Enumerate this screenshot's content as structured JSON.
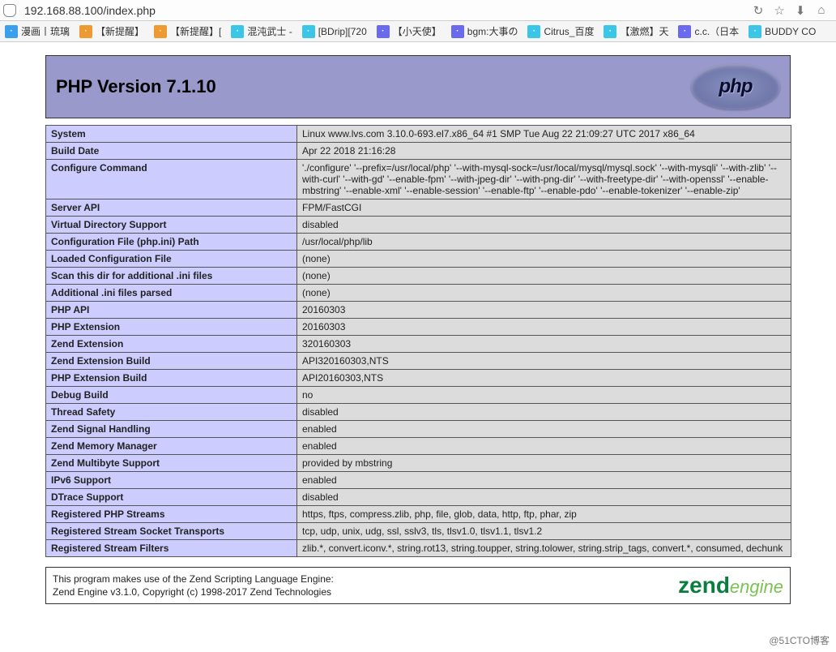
{
  "address_bar": {
    "url": "192.168.88.100/index.php"
  },
  "bookmarks": [
    {
      "label": "漫画丨琉璃",
      "ico": "ico-blue"
    },
    {
      "label": "【新提醒】",
      "ico": "ico-orange"
    },
    {
      "label": "【新提醒】[",
      "ico": "ico-orange"
    },
    {
      "label": "混沌武士 -",
      "ico": "ico-cyan"
    },
    {
      "label": "[BDrip][720",
      "ico": "ico-cyan"
    },
    {
      "label": "【小天使】",
      "ico": "ico-purple"
    },
    {
      "label": "bgm:大事の",
      "ico": "ico-purple"
    },
    {
      "label": "Citrus_百度",
      "ico": "ico-cyan"
    },
    {
      "label": "【激燃】天",
      "ico": "ico-cyan"
    },
    {
      "label": "c.c.（日本",
      "ico": "ico-purple"
    },
    {
      "label": "BUDDY CO",
      "ico": "ico-cyan"
    }
  ],
  "header": {
    "title": "PHP Version 7.1.10",
    "logo_text": "php"
  },
  "rows": [
    {
      "k": "System",
      "v": "Linux www.lvs.com 3.10.0-693.el7.x86_64 #1 SMP Tue Aug 22 21:09:27 UTC 2017 x86_64"
    },
    {
      "k": "Build Date",
      "v": "Apr 22 2018 21:16:28"
    },
    {
      "k": "Configure Command",
      "v": "'./configure' '--prefix=/usr/local/php' '--with-mysql-sock=/usr/local/mysql/mysql.sock' '--with-mysqli' '--with-zlib' '--with-curl' '--with-gd' '--enable-fpm' '--with-jpeg-dir' '--with-png-dir' '--with-freetype-dir' '--with-openssl' '--enable-mbstring' '--enable-xml' '--enable-session' '--enable-ftp' '--enable-pdo' '--enable-tokenizer' '--enable-zip'"
    },
    {
      "k": "Server API",
      "v": "FPM/FastCGI"
    },
    {
      "k": "Virtual Directory Support",
      "v": "disabled"
    },
    {
      "k": "Configuration File (php.ini) Path",
      "v": "/usr/local/php/lib"
    },
    {
      "k": "Loaded Configuration File",
      "v": "(none)"
    },
    {
      "k": "Scan this dir for additional .ini files",
      "v": "(none)"
    },
    {
      "k": "Additional .ini files parsed",
      "v": "(none)"
    },
    {
      "k": "PHP API",
      "v": "20160303"
    },
    {
      "k": "PHP Extension",
      "v": "20160303"
    },
    {
      "k": "Zend Extension",
      "v": "320160303"
    },
    {
      "k": "Zend Extension Build",
      "v": "API320160303,NTS"
    },
    {
      "k": "PHP Extension Build",
      "v": "API20160303,NTS"
    },
    {
      "k": "Debug Build",
      "v": "no"
    },
    {
      "k": "Thread Safety",
      "v": "disabled"
    },
    {
      "k": "Zend Signal Handling",
      "v": "enabled"
    },
    {
      "k": "Zend Memory Manager",
      "v": "enabled"
    },
    {
      "k": "Zend Multibyte Support",
      "v": "provided by mbstring"
    },
    {
      "k": "IPv6 Support",
      "v": "enabled"
    },
    {
      "k": "DTrace Support",
      "v": "disabled"
    },
    {
      "k": "Registered PHP Streams",
      "v": "https, ftps, compress.zlib, php, file, glob, data, http, ftp, phar, zip"
    },
    {
      "k": "Registered Stream Socket Transports",
      "v": "tcp, udp, unix, udg, ssl, sslv3, tls, tlsv1.0, tlsv1.1, tlsv1.2"
    },
    {
      "k": "Registered Stream Filters",
      "v": "zlib.*, convert.iconv.*, string.rot13, string.toupper, string.tolower, string.strip_tags, convert.*, consumed, dechunk"
    }
  ],
  "zend": {
    "line1": "This program makes use of the Zend Scripting Language Engine:",
    "line2": "Zend Engine v3.1.0, Copyright (c) 1998-2017 Zend Technologies",
    "logo_a": "zend",
    "logo_b": "engine"
  },
  "watermark": "@51CTO博客"
}
